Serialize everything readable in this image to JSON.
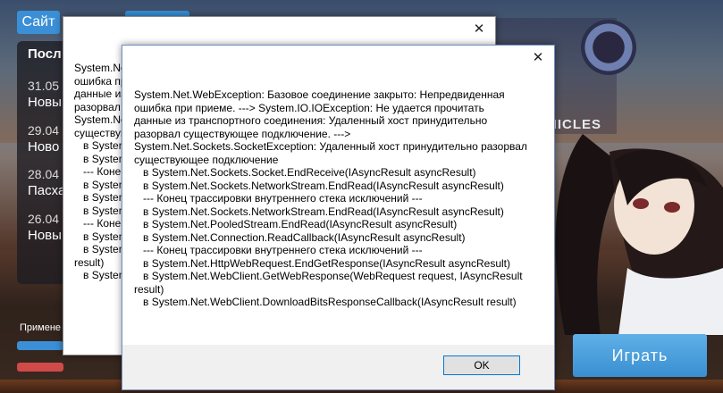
{
  "launcher": {
    "site_button": "Сайт",
    "news": {
      "heading": "Посл",
      "items": [
        {
          "date": "31.05",
          "title": "Новы"
        },
        {
          "date": "29.04",
          "title": "Ново"
        },
        {
          "date": "28.04",
          "title": "Пасха"
        },
        {
          "date": "26.04",
          "title": "Новы"
        }
      ]
    },
    "apply_label": "Примене",
    "progress_bars": [
      {
        "progress": 1.0,
        "color": "#3a8fd6"
      },
      {
        "progress": 1.0,
        "color": "#d04a4a"
      }
    ],
    "play_button": "Играть",
    "logo_text": "NICLES",
    "logo_letters": "ic"
  },
  "dialog_back": {
    "close_glyph": "✕",
    "message_lines": [
      "System.Net.WebException: Базовое соединение закрыто: Непредвиденная",
      "ошибка при приеме. ---> System.IO.IOException: Не удается прочитать",
      "данные из транспортного соединения: Удаленный хост принудительно",
      "разорвал существующее подключение. --->",
      "System.Net.Sockets.SocketException: Удаленный хост принудительно разорвал",
      "существующее подключение",
      "   в System.Net.Sockets.Socket.EndReceive(IAsyncResult asyncResult)",
      "   в System.Net.Sockets.NetworkStream.EndRead(IAsyncResult asyncResult)",
      "   --- Конец трассировки внутреннего стека исключений ---",
      "   в System.Net.Sockets.NetworkStream.EndRead(IAsyncResult asyncResult)",
      "   в System.Net.PooledStream.EndRead(IAsyncResult asyncResult)",
      "   в System.Net.Connection.ReadCallback(IAsyncResult asyncResult)",
      "   --- Конец трассировки внутреннего стека исключений ---",
      "   в System.Net.HttpWebRequest.EndGetResponse(IAsyncResult asyncResult)",
      "   в System.Net.WebClient.GetWebResponse(WebRequest request, IAsyncResult",
      "result)",
      "   в System.Net.WebClient.DownloadBitsResponseCallback(IAsyncResult result)"
    ]
  },
  "dialog_front": {
    "close_glyph": "✕",
    "message_lines": [
      "System.Net.WebException: Базовое соединение закрыто: Непредвиденная",
      "ошибка при приеме. ---> System.IO.IOException: Не удается прочитать",
      "данные из транспортного соединения: Удаленный хост принудительно",
      "разорвал существующее подключение. --->",
      "System.Net.Sockets.SocketException: Удаленный хост принудительно разорвал",
      "существующее подключение",
      "   в System.Net.Sockets.Socket.EndReceive(IAsyncResult asyncResult)",
      "   в System.Net.Sockets.NetworkStream.EndRead(IAsyncResult asyncResult)",
      "   --- Конец трассировки внутреннего стека исключений ---",
      "   в System.Net.Sockets.NetworkStream.EndRead(IAsyncResult asyncResult)",
      "   в System.Net.PooledStream.EndRead(IAsyncResult asyncResult)",
      "   в System.Net.Connection.ReadCallback(IAsyncResult asyncResult)",
      "   --- Конец трассировки внутреннего стека исключений ---",
      "   в System.Net.HttpWebRequest.EndGetResponse(IAsyncResult asyncResult)",
      "   в System.Net.WebClient.GetWebResponse(WebRequest request, IAsyncResult",
      "result)",
      "   в System.Net.WebClient.DownloadBitsResponseCallback(IAsyncResult result)"
    ],
    "ok_button": "OK"
  }
}
